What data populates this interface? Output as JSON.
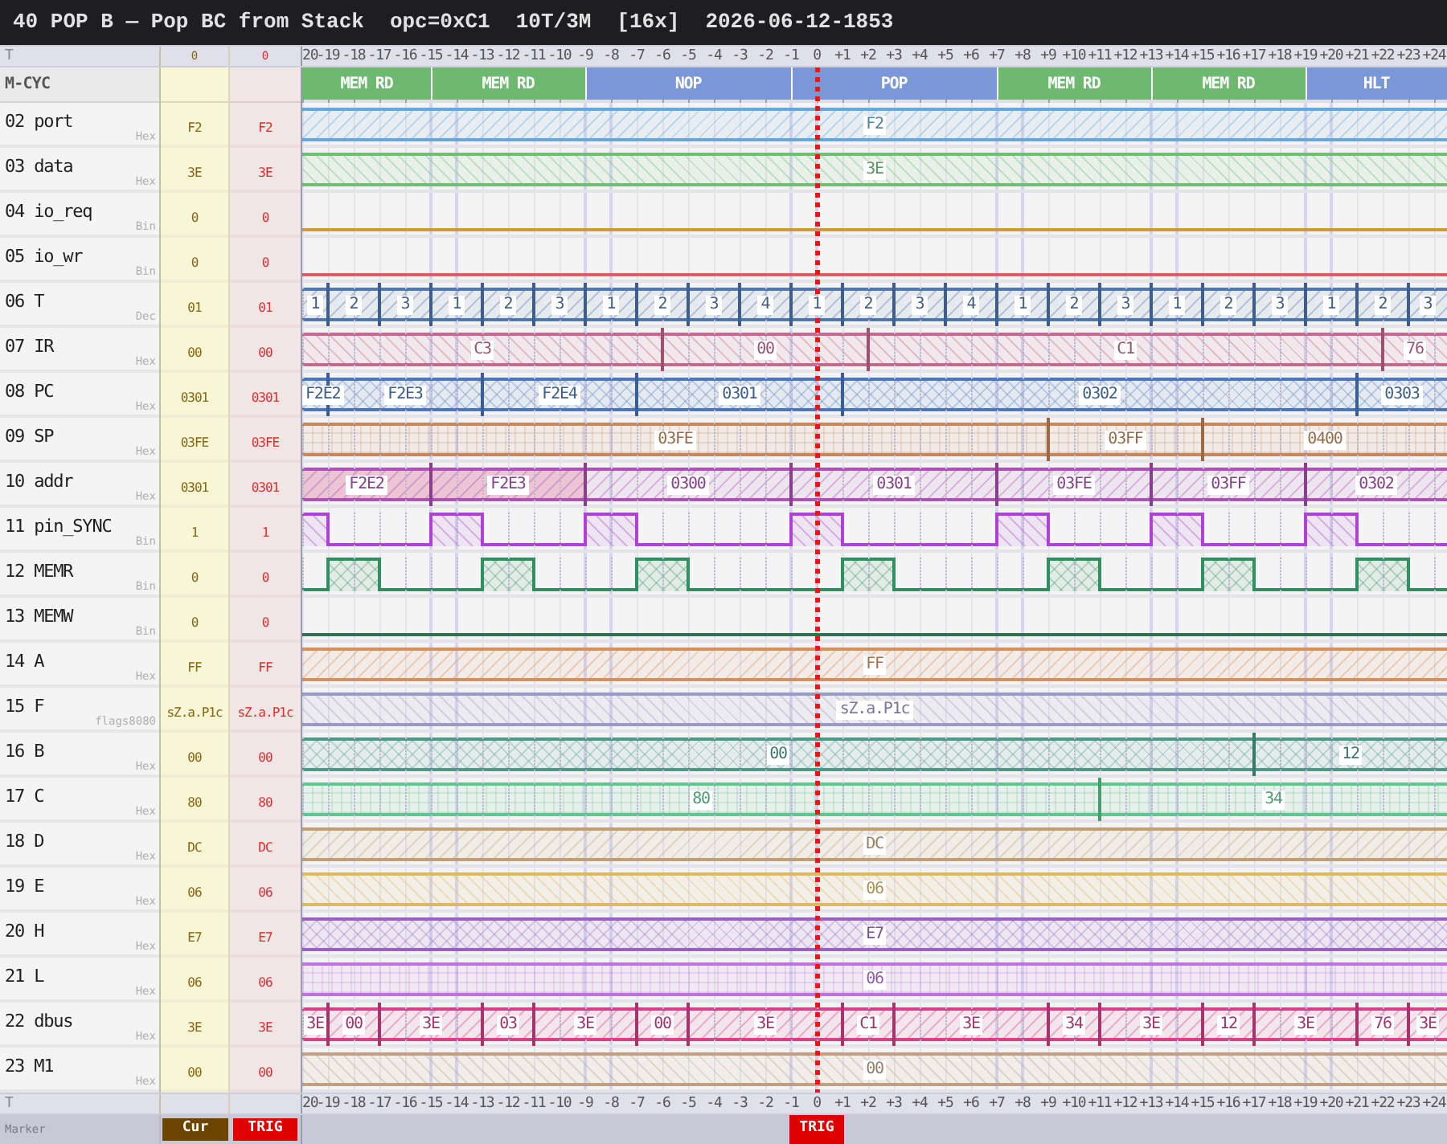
{
  "title_bar": {
    "title": "40 POP B — Pop BC from Stack",
    "opcode": "opc=0xC1",
    "timing": "10T/3M",
    "zoom": "[16x]",
    "timestamp": "2026-06-12-1853"
  },
  "header_row": {
    "label": "T",
    "cur": "0",
    "trig": "0",
    "ticks": [
      {
        "label": "20",
        "trigger": false
      },
      {
        "label": "-19",
        "trigger": false
      },
      {
        "label": "-18",
        "trigger": false
      },
      {
        "label": "-17",
        "trigger": false
      },
      {
        "label": "-16",
        "trigger": false
      },
      {
        "label": "-15",
        "trigger": false
      },
      {
        "label": "-14",
        "trigger": false
      },
      {
        "label": "-13",
        "trigger": false
      },
      {
        "label": "-12",
        "trigger": false
      },
      {
        "label": "-11",
        "trigger": false
      },
      {
        "label": "-10",
        "trigger": false
      },
      {
        "label": "-9",
        "trigger": false
      },
      {
        "label": "-8",
        "trigger": false
      },
      {
        "label": "-7",
        "trigger": false
      },
      {
        "label": "-6",
        "trigger": false
      },
      {
        "label": "-5",
        "trigger": false
      },
      {
        "label": "-4",
        "trigger": false
      },
      {
        "label": "-3",
        "trigger": false
      },
      {
        "label": "-2",
        "trigger": false
      },
      {
        "label": "-1",
        "trigger": false
      },
      {
        "label": "0",
        "trigger": true
      },
      {
        "label": "+1",
        "trigger": false
      },
      {
        "label": "+2",
        "trigger": false
      },
      {
        "label": "+3",
        "trigger": false
      },
      {
        "label": "+4",
        "trigger": false
      },
      {
        "label": "+5",
        "trigger": false
      },
      {
        "label": "+6",
        "trigger": false
      },
      {
        "label": "+7",
        "trigger": false
      },
      {
        "label": "+8",
        "trigger": false
      },
      {
        "label": "+9",
        "trigger": false
      },
      {
        "label": "+10",
        "trigger": false
      },
      {
        "label": "+11",
        "trigger": false
      },
      {
        "label": "+12",
        "trigger": false
      },
      {
        "label": "+13",
        "trigger": false
      },
      {
        "label": "+14",
        "trigger": false
      },
      {
        "label": "+15",
        "trigger": false
      },
      {
        "label": "+16",
        "trigger": false
      },
      {
        "label": "+17",
        "trigger": false
      },
      {
        "label": "+18",
        "trigger": false
      },
      {
        "label": "+19",
        "trigger": false
      },
      {
        "label": "+20",
        "trigger": false
      },
      {
        "label": "+21",
        "trigger": false
      },
      {
        "label": "+22",
        "trigger": false
      },
      {
        "label": "+23",
        "trigger": false
      },
      {
        "label": "+24",
        "trigger": false
      }
    ]
  },
  "mcycle_row": {
    "label": "M-CYC",
    "cycles": [
      {
        "label": "MEM RD",
        "color": "#6db96f"
      },
      {
        "label": "MEM RD",
        "color": "#6db96f"
      },
      {
        "label": "NOP",
        "color": "#7a97d8"
      },
      {
        "label": "POP",
        "color": "#7a97d8"
      },
      {
        "label": "MEM RD",
        "color": "#6db96f"
      },
      {
        "label": "MEM RD",
        "color": "#6db96f"
      },
      {
        "label": "HLT",
        "color": "#7a97d8"
      }
    ],
    "cells": [
      {
        "edge": false
      },
      {
        "edge": false
      },
      {
        "edge": false
      },
      {
        "edge": false
      },
      {
        "edge": false
      },
      {
        "edge": true
      },
      {
        "edge": false
      },
      {
        "edge": false
      },
      {
        "edge": false
      },
      {
        "edge": false
      },
      {
        "edge": false
      },
      {
        "edge": true
      },
      {
        "edge": false
      },
      {
        "edge": false
      },
      {
        "edge": false
      },
      {
        "edge": false
      },
      {
        "edge": false
      },
      {
        "edge": false
      },
      {
        "edge": false
      },
      {
        "edge": true
      },
      {
        "edge": false
      },
      {
        "edge": false
      },
      {
        "edge": false
      },
      {
        "edge": false
      },
      {
        "edge": false
      },
      {
        "edge": false
      },
      {
        "edge": false
      },
      {
        "edge": true
      },
      {
        "edge": false
      },
      {
        "edge": false
      },
      {
        "edge": false
      },
      {
        "edge": false
      },
      {
        "edge": false
      },
      {
        "edge": true
      },
      {
        "edge": false
      },
      {
        "edge": false
      },
      {
        "edge": false
      },
      {
        "edge": false
      },
      {
        "edge": false
      },
      {
        "edge": true
      },
      {
        "edge": false
      },
      {
        "edge": false
      },
      {
        "edge": false
      },
      {
        "edge": false
      },
      {
        "edge": false
      }
    ]
  },
  "signals": [
    {
      "label": "02 port",
      "format": "Hex",
      "cur": "F2",
      "trig": "F2",
      "kind": "bus",
      "color": "#64a8e0",
      "segments": [
        {
          "value": "F2"
        }
      ]
    },
    {
      "label": "03 data",
      "format": "Hex",
      "cur": "3E",
      "trig": "3E",
      "kind": "bus",
      "color": "#6cc070",
      "segments": [
        {
          "value": "3E"
        }
      ]
    },
    {
      "label": "04 io_req",
      "format": "Bin",
      "cur": "0",
      "trig": "0",
      "kind": "bit",
      "color": "#d8963c",
      "runs": [
        {
          "high": false
        }
      ]
    },
    {
      "label": "05 io_wr",
      "format": "Bin",
      "cur": "0",
      "trig": "0",
      "kind": "bit",
      "color": "#d86060",
      "runs": [
        {
          "high": false
        }
      ]
    },
    {
      "label": "06 T",
      "format": "Dec",
      "cur": "01",
      "trig": "01",
      "kind": "bus",
      "color": "#5078b0",
      "segments": [
        {
          "value": "1"
        },
        {
          "value": "2"
        },
        {
          "value": "3"
        },
        {
          "value": "1"
        },
        {
          "value": "2"
        },
        {
          "value": "3"
        },
        {
          "value": "1"
        },
        {
          "value": "2"
        },
        {
          "value": "3"
        },
        {
          "value": "4"
        },
        {
          "value": "1"
        },
        {
          "value": "2"
        },
        {
          "value": "3"
        },
        {
          "value": "4"
        },
        {
          "value": "1"
        },
        {
          "value": "2"
        },
        {
          "value": "3"
        },
        {
          "value": "1"
        },
        {
          "value": "2"
        },
        {
          "value": "3"
        },
        {
          "value": "1"
        },
        {
          "value": "2"
        },
        {
          "value": "3"
        }
      ],
      "cells": [
        {
          "edge": false
        },
        {
          "edge": true
        },
        {
          "edge": false
        },
        {
          "edge": true
        },
        {
          "edge": false
        },
        {
          "edge": true
        },
        {
          "edge": false
        },
        {
          "edge": true
        },
        {
          "edge": false
        },
        {
          "edge": true
        },
        {
          "edge": false
        },
        {
          "edge": true
        },
        {
          "edge": false
        },
        {
          "edge": true
        },
        {
          "edge": false
        },
        {
          "edge": true
        },
        {
          "edge": false
        },
        {
          "edge": true
        },
        {
          "edge": false
        },
        {
          "edge": true
        },
        {
          "edge": false
        },
        {
          "edge": true
        },
        {
          "edge": false
        },
        {
          "edge": true
        },
        {
          "edge": false
        },
        {
          "edge": true
        },
        {
          "edge": false
        },
        {
          "edge": true
        },
        {
          "edge": false
        },
        {
          "edge": true
        },
        {
          "edge": false
        },
        {
          "edge": true
        },
        {
          "edge": false
        },
        {
          "edge": true
        },
        {
          "edge": false
        },
        {
          "edge": true
        },
        {
          "edge": false
        },
        {
          "edge": true
        },
        {
          "edge": false
        },
        {
          "edge": true
        },
        {
          "edge": false
        },
        {
          "edge": true
        },
        {
          "edge": false
        },
        {
          "edge": true
        },
        {
          "edge": false
        }
      ]
    },
    {
      "label": "07 IR",
      "format": "Hex",
      "cur": "00",
      "trig": "00",
      "kind": "bus",
      "color": "#c86890",
      "segments": [
        {
          "value": "C3"
        },
        {
          "value": "00"
        },
        {
          "value": "C1"
        },
        {
          "value": "76"
        }
      ],
      "cells": [
        {
          "edge": false
        },
        {
          "edge": false
        },
        {
          "edge": false
        },
        {
          "edge": false
        },
        {
          "edge": false
        },
        {
          "edge": false
        },
        {
          "edge": false
        },
        {
          "edge": false
        },
        {
          "edge": false
        },
        {
          "edge": false
        },
        {
          "edge": false
        },
        {
          "edge": false
        },
        {
          "edge": false
        },
        {
          "edge": false
        },
        {
          "edge": true
        },
        {
          "edge": false
        },
        {
          "edge": false
        },
        {
          "edge": false
        },
        {
          "edge": false
        },
        {
          "edge": false
        },
        {
          "edge": false
        },
        {
          "edge": false
        },
        {
          "edge": true
        },
        {
          "edge": false
        },
        {
          "edge": false
        },
        {
          "edge": false
        },
        {
          "edge": false
        },
        {
          "edge": false
        },
        {
          "edge": false
        },
        {
          "edge": false
        },
        {
          "edge": false
        },
        {
          "edge": false
        },
        {
          "edge": false
        },
        {
          "edge": false
        },
        {
          "edge": false
        },
        {
          "edge": false
        },
        {
          "edge": false
        },
        {
          "edge": false
        },
        {
          "edge": false
        },
        {
          "edge": false
        },
        {
          "edge": false
        },
        {
          "edge": false
        },
        {
          "edge": true
        },
        {
          "edge": false
        },
        {
          "edge": false
        }
      ]
    },
    {
      "label": "08 PC",
      "format": "Hex",
      "cur": "0301",
      "trig": "0301",
      "kind": "bus",
      "color": "#4a78c0",
      "segments": [
        {
          "value": "F2E2"
        },
        {
          "value": "F2E3"
        },
        {
          "value": "F2E4"
        },
        {
          "value": "0301"
        },
        {
          "value": "0302"
        },
        {
          "value": "0303"
        }
      ],
      "cells": [
        {
          "edge": false
        },
        {
          "edge": true
        },
        {
          "edge": false
        },
        {
          "edge": false
        },
        {
          "edge": false
        },
        {
          "edge": false
        },
        {
          "edge": false
        },
        {
          "edge": true
        },
        {
          "edge": false
        },
        {
          "edge": false
        },
        {
          "edge": false
        },
        {
          "edge": false
        },
        {
          "edge": false
        },
        {
          "edge": true
        },
        {
          "edge": false
        },
        {
          "edge": false
        },
        {
          "edge": false
        },
        {
          "edge": false
        },
        {
          "edge": false
        },
        {
          "edge": false
        },
        {
          "edge": false
        },
        {
          "edge": true
        },
        {
          "edge": false
        },
        {
          "edge": false
        },
        {
          "edge": false
        },
        {
          "edge": false
        },
        {
          "edge": false
        },
        {
          "edge": false
        },
        {
          "edge": false
        },
        {
          "edge": false
        },
        {
          "edge": false
        },
        {
          "edge": false
        },
        {
          "edge": false
        },
        {
          "edge": false
        },
        {
          "edge": false
        },
        {
          "edge": false
        },
        {
          "edge": false
        },
        {
          "edge": false
        },
        {
          "edge": false
        },
        {
          "edge": false
        },
        {
          "edge": false
        },
        {
          "edge": true
        },
        {
          "edge": false
        },
        {
          "edge": false
        },
        {
          "edge": false
        }
      ]
    },
    {
      "label": "09 SP",
      "format": "Hex",
      "cur": "03FE",
      "trig": "03FE",
      "kind": "bus",
      "color": "#c8865a",
      "segments": [
        {
          "value": "03FE"
        },
        {
          "value": "03FF"
        },
        {
          "value": "0400"
        }
      ],
      "cells": [
        {
          "edge": false
        },
        {
          "edge": false
        },
        {
          "edge": false
        },
        {
          "edge": false
        },
        {
          "edge": false
        },
        {
          "edge": false
        },
        {
          "edge": false
        },
        {
          "edge": false
        },
        {
          "edge": false
        },
        {
          "edge": false
        },
        {
          "edge": false
        },
        {
          "edge": false
        },
        {
          "edge": false
        },
        {
          "edge": false
        },
        {
          "edge": false
        },
        {
          "edge": false
        },
        {
          "edge": false
        },
        {
          "edge": false
        },
        {
          "edge": false
        },
        {
          "edge": false
        },
        {
          "edge": false
        },
        {
          "edge": false
        },
        {
          "edge": false
        },
        {
          "edge": false
        },
        {
          "edge": false
        },
        {
          "edge": false
        },
        {
          "edge": false
        },
        {
          "edge": false
        },
        {
          "edge": false
        },
        {
          "edge": true
        },
        {
          "edge": false
        },
        {
          "edge": false
        },
        {
          "edge": false
        },
        {
          "edge": false
        },
        {
          "edge": false
        },
        {
          "edge": true
        },
        {
          "edge": false
        },
        {
          "edge": false
        },
        {
          "edge": false
        },
        {
          "edge": false
        },
        {
          "edge": false
        },
        {
          "edge": false
        },
        {
          "edge": false
        },
        {
          "edge": false
        },
        {
          "edge": false
        }
      ]
    },
    {
      "label": "10 addr",
      "format": "Hex",
      "cur": "0301",
      "trig": "0301",
      "kind": "bus",
      "color": "#b050b8",
      "segments": [
        {
          "value": "F2E2",
          "highlighted": true
        },
        {
          "value": "F2E3",
          "highlighted": true
        },
        {
          "value": "0300",
          "highlighted": false
        },
        {
          "value": "0301",
          "highlighted": false
        },
        {
          "value": "03FE",
          "highlighted": false
        },
        {
          "value": "03FF",
          "highlighted": false
        },
        {
          "value": "0302",
          "highlighted": false
        }
      ],
      "cells": [
        {
          "edge": false
        },
        {
          "edge": false
        },
        {
          "edge": false
        },
        {
          "edge": false
        },
        {
          "edge": false
        },
        {
          "edge": true
        },
        {
          "edge": false
        },
        {
          "edge": false
        },
        {
          "edge": false
        },
        {
          "edge": false
        },
        {
          "edge": false
        },
        {
          "edge": true
        },
        {
          "edge": false
        },
        {
          "edge": false
        },
        {
          "edge": false
        },
        {
          "edge": false
        },
        {
          "edge": false
        },
        {
          "edge": false
        },
        {
          "edge": false
        },
        {
          "edge": true
        },
        {
          "edge": false
        },
        {
          "edge": false
        },
        {
          "edge": false
        },
        {
          "edge": false
        },
        {
          "edge": false
        },
        {
          "edge": false
        },
        {
          "edge": false
        },
        {
          "edge": true
        },
        {
          "edge": false
        },
        {
          "edge": false
        },
        {
          "edge": false
        },
        {
          "edge": false
        },
        {
          "edge": false
        },
        {
          "edge": true
        },
        {
          "edge": false
        },
        {
          "edge": false
        },
        {
          "edge": false
        },
        {
          "edge": false
        },
        {
          "edge": false
        },
        {
          "edge": true
        },
        {
          "edge": false
        },
        {
          "edge": false
        },
        {
          "edge": false
        },
        {
          "edge": false
        },
        {
          "edge": false
        }
      ]
    },
    {
      "label": "11 pin_SYNC",
      "format": "Bin",
      "cur": "1",
      "trig": "1",
      "kind": "bit",
      "color": "#b040d8",
      "runs": [
        {
          "high": true
        },
        {
          "high": false
        },
        {
          "high": true
        },
        {
          "high": false
        },
        {
          "high": true
        },
        {
          "high": false
        },
        {
          "high": true
        },
        {
          "high": false
        },
        {
          "high": true
        },
        {
          "high": false
        },
        {
          "high": true
        },
        {
          "high": false
        },
        {
          "high": true
        },
        {
          "high": false
        }
      ],
      "cells": [
        {
          "edge": false
        },
        {
          "edge": true
        },
        {
          "edge": false
        },
        {
          "edge": false
        },
        {
          "edge": false
        },
        {
          "edge": true
        },
        {
          "edge": false
        },
        {
          "edge": true
        },
        {
          "edge": false
        },
        {
          "edge": false
        },
        {
          "edge": false
        },
        {
          "edge": true
        },
        {
          "edge": false
        },
        {
          "edge": true
        },
        {
          "edge": false
        },
        {
          "edge": false
        },
        {
          "edge": false
        },
        {
          "edge": false
        },
        {
          "edge": false
        },
        {
          "edge": true
        },
        {
          "edge": false
        },
        {
          "edge": true
        },
        {
          "edge": false
        },
        {
          "edge": false
        },
        {
          "edge": false
        },
        {
          "edge": false
        },
        {
          "edge": false
        },
        {
          "edge": true
        },
        {
          "edge": false
        },
        {
          "edge": true
        },
        {
          "edge": false
        },
        {
          "edge": false
        },
        {
          "edge": false
        },
        {
          "edge": true
        },
        {
          "edge": false
        },
        {
          "edge": true
        },
        {
          "edge": false
        },
        {
          "edge": false
        },
        {
          "edge": false
        },
        {
          "edge": true
        },
        {
          "edge": false
        },
        {
          "edge": true
        },
        {
          "edge": false
        },
        {
          "edge": false
        },
        {
          "edge": false
        }
      ]
    },
    {
      "label": "12 MEMR",
      "format": "Bin",
      "cur": "0",
      "trig": "0",
      "kind": "bit",
      "color": "#2e9060",
      "runs": [
        {
          "high": false
        },
        {
          "high": true
        },
        {
          "high": false
        },
        {
          "high": true
        },
        {
          "high": false
        },
        {
          "high": true
        },
        {
          "high": false
        },
        {
          "high": true
        },
        {
          "high": false
        },
        {
          "high": true
        },
        {
          "high": false
        },
        {
          "high": true
        },
        {
          "high": false
        },
        {
          "high": true
        },
        {
          "high": false
        }
      ],
      "cells": [
        {
          "edge": false
        },
        {
          "edge": true
        },
        {
          "edge": false
        },
        {
          "edge": true
        },
        {
          "edge": false
        },
        {
          "edge": false
        },
        {
          "edge": false
        },
        {
          "edge": true
        },
        {
          "edge": false
        },
        {
          "edge": true
        },
        {
          "edge": false
        },
        {
          "edge": false
        },
        {
          "edge": false
        },
        {
          "edge": true
        },
        {
          "edge": false
        },
        {
          "edge": true
        },
        {
          "edge": false
        },
        {
          "edge": false
        },
        {
          "edge": false
        },
        {
          "edge": false
        },
        {
          "edge": false
        },
        {
          "edge": true
        },
        {
          "edge": false
        },
        {
          "edge": true
        },
        {
          "edge": false
        },
        {
          "edge": false
        },
        {
          "edge": false
        },
        {
          "edge": false
        },
        {
          "edge": false
        },
        {
          "edge": true
        },
        {
          "edge": false
        },
        {
          "edge": true
        },
        {
          "edge": false
        },
        {
          "edge": false
        },
        {
          "edge": false
        },
        {
          "edge": true
        },
        {
          "edge": false
        },
        {
          "edge": true
        },
        {
          "edge": false
        },
        {
          "edge": false
        },
        {
          "edge": false
        },
        {
          "edge": true
        },
        {
          "edge": false
        },
        {
          "edge": true
        },
        {
          "edge": false
        }
      ]
    },
    {
      "label": "13 MEMW",
      "format": "Bin",
      "cur": "0",
      "trig": "0",
      "kind": "bit",
      "color": "#2e7050",
      "runs": [
        {
          "high": false
        }
      ]
    },
    {
      "label": "14 A",
      "format": "Hex",
      "cur": "FF",
      "trig": "FF",
      "kind": "bus",
      "color": "#d8905a",
      "segments": [
        {
          "value": "FF"
        }
      ]
    },
    {
      "label": "15 F",
      "format": "flags8080",
      "cur": "sZ.a.P1c",
      "trig": "sZ.a.P1c",
      "kind": "bus",
      "color": "#9a9ac8",
      "segments": [
        {
          "value": "sZ.a.P1c"
        }
      ]
    },
    {
      "label": "16 B",
      "format": "Hex",
      "cur": "00",
      "trig": "00",
      "kind": "bus",
      "color": "#4a9a88",
      "segments": [
        {
          "value": "00"
        },
        {
          "value": "12"
        }
      ],
      "cells": [
        {
          "edge": false
        },
        {
          "edge": false
        },
        {
          "edge": false
        },
        {
          "edge": false
        },
        {
          "edge": false
        },
        {
          "edge": false
        },
        {
          "edge": false
        },
        {
          "edge": false
        },
        {
          "edge": false
        },
        {
          "edge": false
        },
        {
          "edge": false
        },
        {
          "edge": false
        },
        {
          "edge": false
        },
        {
          "edge": false
        },
        {
          "edge": false
        },
        {
          "edge": false
        },
        {
          "edge": false
        },
        {
          "edge": false
        },
        {
          "edge": false
        },
        {
          "edge": false
        },
        {
          "edge": false
        },
        {
          "edge": false
        },
        {
          "edge": false
        },
        {
          "edge": false
        },
        {
          "edge": false
        },
        {
          "edge": false
        },
        {
          "edge": false
        },
        {
          "edge": false
        },
        {
          "edge": false
        },
        {
          "edge": false
        },
        {
          "edge": false
        },
        {
          "edge": false
        },
        {
          "edge": false
        },
        {
          "edge": false
        },
        {
          "edge": false
        },
        {
          "edge": false
        },
        {
          "edge": false
        },
        {
          "edge": true
        },
        {
          "edge": false
        },
        {
          "edge": false
        },
        {
          "edge": false
        },
        {
          "edge": false
        },
        {
          "edge": false
        },
        {
          "edge": false
        },
        {
          "edge": false
        }
      ]
    },
    {
      "label": "17 C",
      "format": "Hex",
      "cur": "80",
      "trig": "80",
      "kind": "bus",
      "color": "#5cc890",
      "segments": [
        {
          "value": "80"
        },
        {
          "value": "34"
        }
      ],
      "cells": [
        {
          "edge": false
        },
        {
          "edge": false
        },
        {
          "edge": false
        },
        {
          "edge": false
        },
        {
          "edge": false
        },
        {
          "edge": false
        },
        {
          "edge": false
        },
        {
          "edge": false
        },
        {
          "edge": false
        },
        {
          "edge": false
        },
        {
          "edge": false
        },
        {
          "edge": false
        },
        {
          "edge": false
        },
        {
          "edge": false
        },
        {
          "edge": false
        },
        {
          "edge": false
        },
        {
          "edge": false
        },
        {
          "edge": false
        },
        {
          "edge": false
        },
        {
          "edge": false
        },
        {
          "edge": false
        },
        {
          "edge": false
        },
        {
          "edge": false
        },
        {
          "edge": false
        },
        {
          "edge": false
        },
        {
          "edge": false
        },
        {
          "edge": false
        },
        {
          "edge": false
        },
        {
          "edge": false
        },
        {
          "edge": false
        },
        {
          "edge": false
        },
        {
          "edge": true
        },
        {
          "edge": false
        },
        {
          "edge": false
        },
        {
          "edge": false
        },
        {
          "edge": false
        },
        {
          "edge": false
        },
        {
          "edge": false
        },
        {
          "edge": false
        },
        {
          "edge": false
        },
        {
          "edge": false
        },
        {
          "edge": false
        },
        {
          "edge": false
        },
        {
          "edge": false
        },
        {
          "edge": false
        }
      ]
    },
    {
      "label": "18 D",
      "format": "Hex",
      "cur": "DC",
      "trig": "DC",
      "kind": "bus",
      "color": "#c0a070",
      "segments": [
        {
          "value": "DC"
        }
      ]
    },
    {
      "label": "19 E",
      "format": "Hex",
      "cur": "06",
      "trig": "06",
      "kind": "bus",
      "color": "#e0b860",
      "segments": [
        {
          "value": "06"
        }
      ]
    },
    {
      "label": "20 H",
      "format": "Hex",
      "cur": "E7",
      "trig": "E7",
      "kind": "bus",
      "color": "#9a60c8",
      "segments": [
        {
          "value": "E7"
        }
      ]
    },
    {
      "label": "21 L",
      "format": "Hex",
      "cur": "06",
      "trig": "06",
      "kind": "bus",
      "color": "#c070e0",
      "segments": [
        {
          "value": "06"
        }
      ]
    },
    {
      "label": "22 dbus",
      "format": "Hex",
      "cur": "3E",
      "trig": "3E",
      "kind": "bus",
      "color": "#d84088",
      "segments": [
        {
          "value": "3E"
        },
        {
          "value": "00"
        },
        {
          "value": "3E"
        },
        {
          "value": "03"
        },
        {
          "value": "3E"
        },
        {
          "value": "00"
        },
        {
          "value": "3E"
        },
        {
          "value": "C1"
        },
        {
          "value": "3E"
        },
        {
          "value": "34"
        },
        {
          "value": "3E"
        },
        {
          "value": "12"
        },
        {
          "value": "3E"
        },
        {
          "value": "76"
        },
        {
          "value": "3E"
        }
      ],
      "cells": [
        {
          "edge": false
        },
        {
          "edge": true
        },
        {
          "edge": false
        },
        {
          "edge": true
        },
        {
          "edge": false
        },
        {
          "edge": false
        },
        {
          "edge": false
        },
        {
          "edge": true
        },
        {
          "edge": false
        },
        {
          "edge": true
        },
        {
          "edge": false
        },
        {
          "edge": false
        },
        {
          "edge": false
        },
        {
          "edge": true
        },
        {
          "edge": false
        },
        {
          "edge": true
        },
        {
          "edge": false
        },
        {
          "edge": false
        },
        {
          "edge": false
        },
        {
          "edge": false
        },
        {
          "edge": false
        },
        {
          "edge": true
        },
        {
          "edge": false
        },
        {
          "edge": true
        },
        {
          "edge": false
        },
        {
          "edge": false
        },
        {
          "edge": false
        },
        {
          "edge": false
        },
        {
          "edge": false
        },
        {
          "edge": true
        },
        {
          "edge": false
        },
        {
          "edge": true
        },
        {
          "edge": false
        },
        {
          "edge": false
        },
        {
          "edge": false
        },
        {
          "edge": true
        },
        {
          "edge": false
        },
        {
          "edge": true
        },
        {
          "edge": false
        },
        {
          "edge": false
        },
        {
          "edge": false
        },
        {
          "edge": true
        },
        {
          "edge": false
        },
        {
          "edge": true
        },
        {
          "edge": false
        }
      ]
    },
    {
      "label": "23 M1",
      "format": "Hex",
      "cur": "00",
      "trig": "00",
      "kind": "bus",
      "color": "#c0a080",
      "segments": [
        {
          "value": "00"
        }
      ]
    }
  ],
  "footer_row": {
    "label": "T",
    "ticks": [
      "20",
      "-19",
      "-18",
      "-17",
      "-16",
      "-15",
      "-14",
      "-13",
      "-12",
      "-11",
      "-10",
      "-9",
      "-8",
      "-7",
      "-6",
      "-5",
      "-4",
      "-3",
      "-2",
      "-1",
      "0",
      "+1",
      "+2",
      "+3",
      "+4",
      "+5",
      "+6",
      "+7",
      "+8",
      "+9",
      "+10",
      "+11",
      "+12",
      "+13",
      "+14",
      "+15",
      "+16",
      "+17",
      "+18",
      "+19",
      "+20",
      "+21",
      "+22",
      "+23",
      "+24"
    ]
  },
  "marker_row": {
    "label": "Marker",
    "cur_marker": "Cur",
    "trig_marker": "TRIG",
    "markers": [
      {
        "label": "TRIG"
      }
    ]
  }
}
